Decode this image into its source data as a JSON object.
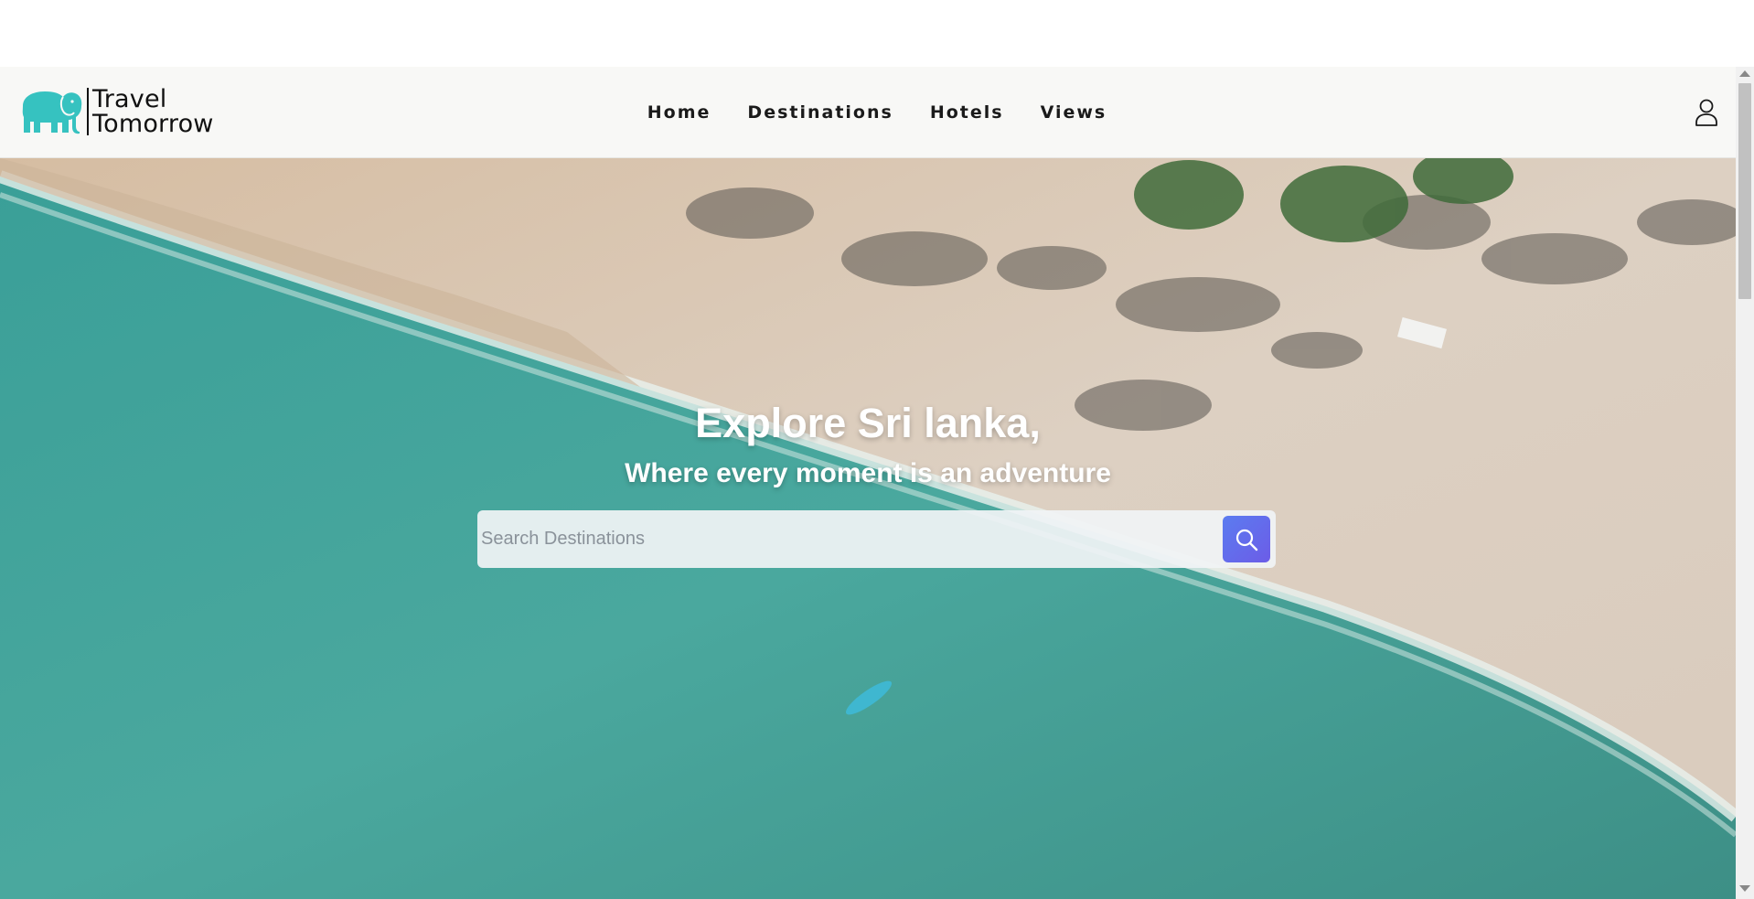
{
  "brand": {
    "line1": "Travel",
    "line2": "Tomorrow",
    "logo_icon": "elephant-icon",
    "logo_color": "#36c2c0"
  },
  "nav": {
    "items": [
      {
        "label": "Home"
      },
      {
        "label": "Destinations"
      },
      {
        "label": "Hotels"
      },
      {
        "label": "Views"
      }
    ],
    "user_icon": "user-icon"
  },
  "hero": {
    "title": "Explore Sri lanka,",
    "subtitle": "Where every moment is an adventure",
    "background": "aerial beach with turquoise sea, sand and palm trees"
  },
  "search": {
    "placeholder": "Search Destinations",
    "value": "",
    "button_icon": "search-icon",
    "button_color": "#6366f1"
  },
  "colors": {
    "navbar_bg": "#f8f8f6",
    "sea": "#3fa79c",
    "sand": "#d8c6b0",
    "text_dark": "#1a1a1a"
  }
}
